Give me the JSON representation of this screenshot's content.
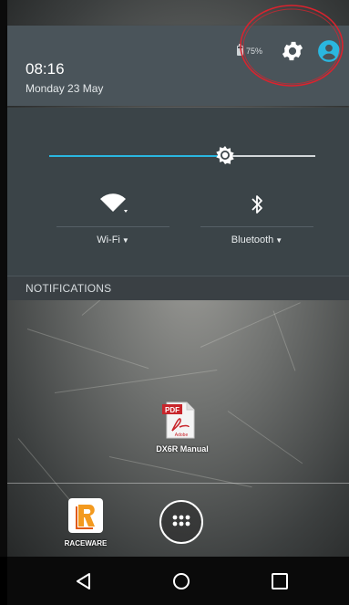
{
  "status": {
    "battery_text": "75%"
  },
  "header": {
    "time": "08:16",
    "date": "Monday 23 May"
  },
  "quick_settings": {
    "brightness_level": 0.66,
    "tiles": [
      {
        "label": "Wi-Fi",
        "icon": "wifi-icon"
      },
      {
        "label": "Bluetooth",
        "icon": "bluetooth-icon"
      }
    ]
  },
  "notifications": {
    "label": "NOTIFICATIONS"
  },
  "desktop": {
    "pdf_badge": "PDF",
    "pdf_brand": "Adobe",
    "file_label": "DX6R Manual"
  },
  "dock": {
    "app_label": "RACEWARE"
  },
  "colors": {
    "accent": "#2ab7e0",
    "header_bg": "#4a545a",
    "panel_bg": "#3b4448",
    "annotation": "#d9232e"
  },
  "icons": [
    "battery-icon",
    "gear-icon",
    "user-icon",
    "wifi-icon",
    "bluetooth-icon",
    "pdf-icon",
    "raceware-icon",
    "apps-icon",
    "back-icon",
    "home-icon",
    "recents-icon"
  ]
}
